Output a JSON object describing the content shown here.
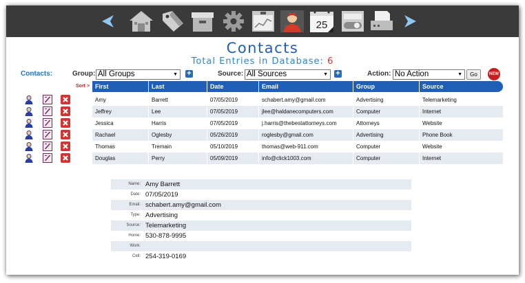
{
  "page": {
    "title": "Contacts",
    "total_label": "Total Entries in Database:",
    "total_count": "6"
  },
  "toolbar": {
    "icons": [
      "back-arrow-icon",
      "home-icon",
      "tag-icon",
      "archive-box-icon",
      "gear-icon",
      "chart-icon",
      "person-icon",
      "calendar-icon",
      "toggle-icon",
      "printer-icon",
      "forward-arrow-icon"
    ],
    "calendar_day": "25"
  },
  "filters": {
    "contacts_label": "Contacts:",
    "group_label": "Group:",
    "group_value": "All Groups",
    "source_label": "Source:",
    "source_value": "All Sources",
    "action_label": "Action:",
    "action_value": "No Action",
    "go_label": "Go",
    "new_label": "NEW"
  },
  "table": {
    "sort_label": "Sort >",
    "columns": [
      "First",
      "Last",
      "Date",
      "Email",
      "Group",
      "Source"
    ],
    "rows": [
      [
        "Amy",
        "Barrett",
        "07/05/2019",
        "schabert.amy@gmail.com",
        "Advertising",
        "Telemarketing"
      ],
      [
        "Jeffrey",
        "Lee",
        "07/05/2019",
        "jlee@haldanecomputers.com",
        "Computer",
        "Internet"
      ],
      [
        "Jessica",
        "Harris",
        "07/05/2019",
        "j.harris@thebestattorneys.com",
        "Attorneys",
        "Website"
      ],
      [
        "Rachael",
        "Oglesby",
        "05/26/2019",
        "roglesby@gmail.com",
        "Advertising",
        "Phone Book"
      ],
      [
        "Thomas",
        "Tremain",
        "05/10/2019",
        "thomas@web-911.com",
        "Computer",
        "Website"
      ],
      [
        "Douglas",
        "Perry",
        "05/09/2019",
        "info@click1003.com",
        "Computer",
        "Internet"
      ]
    ]
  },
  "detail": [
    {
      "label": "Name:",
      "value": "Amy Barrett"
    },
    {
      "label": "Date:",
      "value": "07/05/2019"
    },
    {
      "label": "Email:",
      "value": "schabert.amy@gmail.com"
    },
    {
      "label": "Type:",
      "value": "Advertising"
    },
    {
      "label": "Source:",
      "value": "Telemarketing"
    },
    {
      "label": "Home:",
      "value": "530-878-9995"
    },
    {
      "label": "Work:",
      "value": ""
    },
    {
      "label": "Cell:",
      "value": "254-319-0169"
    }
  ],
  "colors": {
    "accent": "#1f5fb8",
    "count": "#d6312f",
    "toolbar": "#3a3a3a",
    "row_alt": "#e6ebf2"
  }
}
